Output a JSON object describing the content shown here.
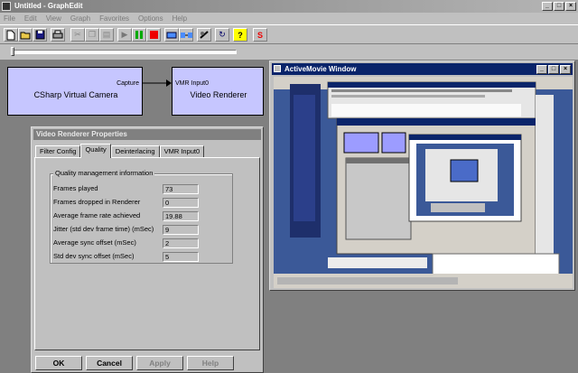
{
  "app": {
    "title": "Untitled - GraphEdit",
    "menu": [
      "File",
      "Edit",
      "View",
      "Graph",
      "Favorites",
      "Options",
      "Help"
    ]
  },
  "toolbar": {
    "buttons": [
      "new-icon",
      "open-icon",
      "save-icon",
      "print-icon",
      "cut-icon",
      "copy-icon",
      "paste-icon",
      "undo-icon",
      "play-icon",
      "pause-icon",
      "stop-icon",
      "filter-icon",
      "connect-icon",
      "seek-icon",
      "refresh-icon",
      "help-icon",
      "s-icon"
    ]
  },
  "graph": {
    "source_filter": {
      "name": "CSharp Virtual Camera",
      "pin": "Capture"
    },
    "renderer_filter": {
      "name": "Video Renderer",
      "pin": "VMR Input0"
    }
  },
  "properties": {
    "title": "Video Renderer Properties",
    "tabs": [
      "Filter Config",
      "Quality",
      "Deinterlacing",
      "VMR Input0"
    ],
    "active_tab": "Quality",
    "group_label": "Quality management information",
    "rows": [
      {
        "label": "Frames played",
        "value": "73"
      },
      {
        "label": "Frames dropped in Renderer",
        "value": "0"
      },
      {
        "label": "Average frame rate achieved",
        "value": "19.88"
      },
      {
        "label": "Jitter (std dev frame time) (mSec)",
        "value": "9"
      },
      {
        "label": "Average sync offset (mSec)",
        "value": "2"
      },
      {
        "label": "Std dev sync offset (mSec)",
        "value": "5"
      }
    ],
    "buttons": {
      "ok": "OK",
      "cancel": "Cancel",
      "apply": "Apply",
      "help": "Help"
    }
  },
  "activemovie": {
    "title": "ActiveMovie Window"
  },
  "colors": {
    "filter_fill": "#c6c6ff",
    "active_title": "#0a246a",
    "inactive_title": "#808080",
    "desktop_blue": "#3b5998"
  }
}
